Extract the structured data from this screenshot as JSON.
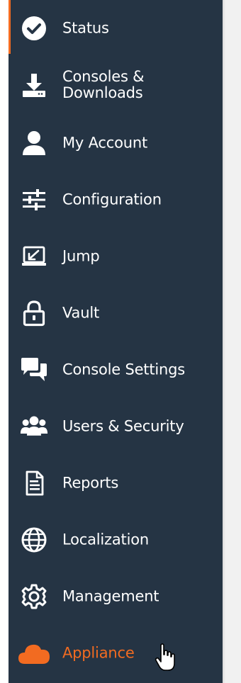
{
  "sidebar": {
    "items": [
      {
        "label": "Status",
        "icon": "check-circle-icon",
        "state": "active"
      },
      {
        "label": "Consoles & Downloads",
        "icon": "download-icon"
      },
      {
        "label": "My Account",
        "icon": "user-icon"
      },
      {
        "label": "Configuration",
        "icon": "sliders-icon"
      },
      {
        "label": "Jump",
        "icon": "jump-icon"
      },
      {
        "label": "Vault",
        "icon": "lock-icon"
      },
      {
        "label": "Console Settings",
        "icon": "chat-bubbles-icon"
      },
      {
        "label": "Users & Security",
        "icon": "users-icon"
      },
      {
        "label": "Reports",
        "icon": "report-document-icon"
      },
      {
        "label": "Localization",
        "icon": "globe-icon"
      },
      {
        "label": "Management",
        "icon": "gear-icon"
      },
      {
        "label": "Appliance",
        "icon": "cloud-icon",
        "state": "hover"
      }
    ]
  },
  "colors": {
    "sidebar_bg": "#253444",
    "accent": "#f26b21",
    "text": "#ffffff"
  }
}
